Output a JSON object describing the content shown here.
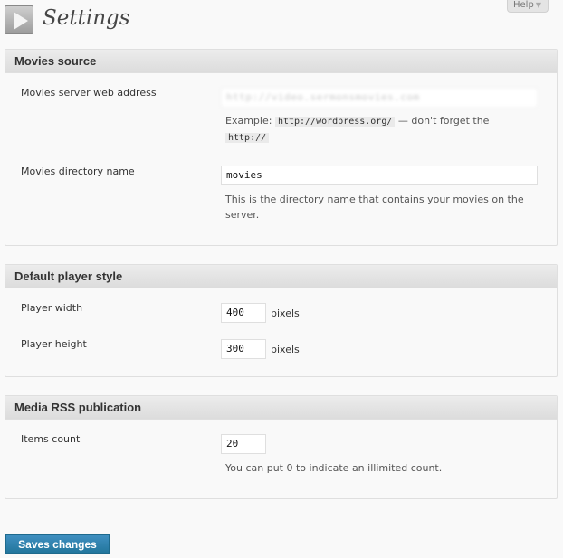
{
  "help": {
    "label": "Help",
    "arrow": "▼"
  },
  "header": {
    "icon": "play-icon",
    "title": "Settings"
  },
  "movies_source": {
    "title": "Movies source",
    "server_label": "Movies server web address",
    "server_value": "http://video.sermonsmovies.com",
    "server_example_prefix": "Example:",
    "server_example_code": "http://wordpress.org/",
    "server_example_suffix": " — don't forget the",
    "server_example_code2": "http://",
    "dir_label": "Movies directory name",
    "dir_value": "movies",
    "dir_desc_line1": "This is the directory name that contains your movies on the",
    "dir_desc_line2": "server."
  },
  "player_style": {
    "title": "Default player style",
    "width_label": "Player width",
    "width_value": "400",
    "height_label": "Player height",
    "height_value": "300",
    "unit": "pixels"
  },
  "rss": {
    "title": "Media RSS publication",
    "count_label": "Items count",
    "count_value": "20",
    "count_desc": "You can put 0 to indicate an illimited count."
  },
  "save_label": "Saves changes"
}
